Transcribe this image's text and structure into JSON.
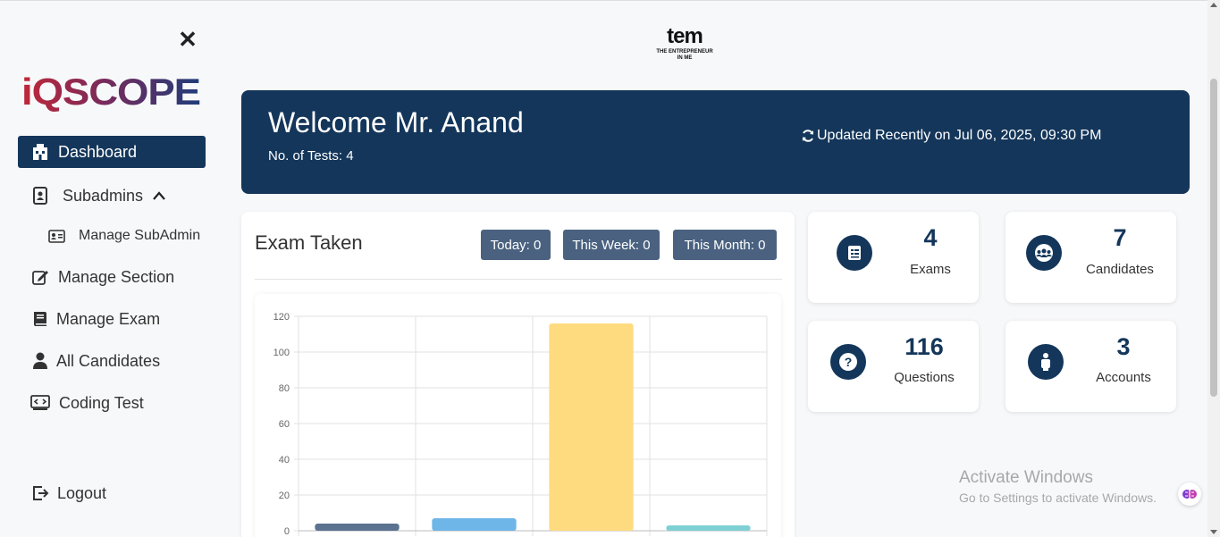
{
  "sidebar": {
    "brand": "iQSCOPE",
    "close_icon": "close-icon",
    "items": [
      {
        "label": "Dashboard",
        "icon": "building-icon",
        "active": true
      },
      {
        "label": "Subadmins",
        "icon": "contacts-icon",
        "expanded": true
      },
      {
        "label": "Manage SubAdmin",
        "icon": "id-card-icon"
      },
      {
        "label": "Manage Section",
        "icon": "edit-icon"
      },
      {
        "label": "Manage Exam",
        "icon": "book-icon"
      },
      {
        "label": "All Candidates",
        "icon": "user-icon"
      },
      {
        "label": "Coding Test",
        "icon": "code-icon"
      }
    ],
    "logout": "Logout"
  },
  "header": {
    "logo_main": "tem",
    "logo_line1": "THE ENTREPRENEUR",
    "logo_line2": "IN ME"
  },
  "welcome": {
    "title": "Welcome Mr. Anand",
    "tests": "No. of Tests: 4",
    "updated": "Updated Recently on Jul 06, 2025, 09:30 PM"
  },
  "exam_taken": {
    "title": "Exam Taken",
    "today": "Today: 0",
    "week": "This Week: 0",
    "month": "This Month: 0"
  },
  "stats": [
    {
      "value": "4",
      "label": "Exams",
      "icon": "exam-list-icon"
    },
    {
      "value": "7",
      "label": "Candidates",
      "icon": "group-icon"
    },
    {
      "value": "116",
      "label": "Questions",
      "icon": "question-icon"
    },
    {
      "value": "3",
      "label": "Accounts",
      "icon": "person-icon"
    }
  ],
  "watermark": {
    "line1": "Activate Windows",
    "line2": "Go to Settings to activate Windows."
  },
  "colors": {
    "primary": "#14365a",
    "pill": "#4a6280",
    "bar1": "#5b7290",
    "bar2": "#6fb6e8",
    "bar3": "#ffdb80",
    "bar4": "#7fd0d4"
  },
  "chart_data": {
    "type": "bar",
    "categories": [
      "",
      "",
      "",
      ""
    ],
    "values": [
      4,
      7,
      116,
      3
    ],
    "ylim": [
      0,
      120
    ],
    "yticks": [
      0,
      20,
      40,
      60,
      80,
      100,
      120
    ],
    "grid": true
  }
}
